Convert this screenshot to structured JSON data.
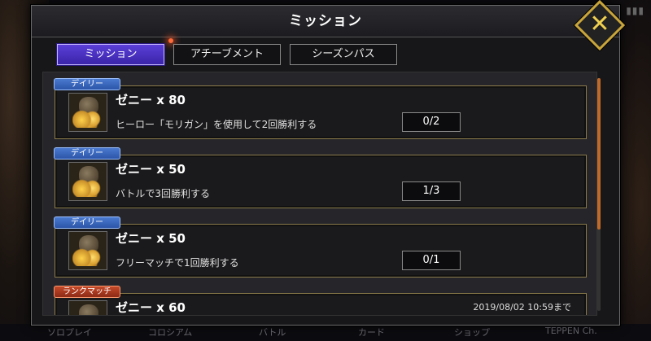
{
  "header": {
    "title": "ミッション"
  },
  "status": {
    "icon": "signal-icon"
  },
  "tabs": [
    {
      "label": "ミッション",
      "active": true
    },
    {
      "label": "アチーブメント",
      "active": false
    },
    {
      "label": "シーズンパス",
      "active": false
    }
  ],
  "missions": [
    {
      "badge": "デイリー",
      "title": "ゼニー x 80",
      "description": "ヒーロー「モリガン」を使用して2回勝利する",
      "progress": "0/2",
      "icon": "zeny-bag-icon"
    },
    {
      "badge": "デイリー",
      "title": "ゼニー x 50",
      "description": "バトルで3回勝利する",
      "progress": "1/3",
      "icon": "zeny-bag-icon"
    },
    {
      "badge": "デイリー",
      "title": "ゼニー x 50",
      "description": "フリーマッチで1回勝利する",
      "progress": "0/1",
      "icon": "zeny-bag-icon"
    },
    {
      "badge": "ランクマッチ",
      "title": "ゼニー x 60",
      "deadline": "2019/08/02 10:59まで",
      "icon": "zeny-bag-icon"
    }
  ],
  "bottom_nav": [
    {
      "label": "ソロプレイ"
    },
    {
      "label": "コロシアム"
    },
    {
      "label": "バトル"
    },
    {
      "label": "カード"
    },
    {
      "label": "ショップ"
    },
    {
      "label": "TEPPEN Ch."
    }
  ],
  "colors": {
    "active_tab": "#4a30c0",
    "daily_badge": "#3a66c0",
    "rank_badge": "#b03a20",
    "close_gold": "#f0d050"
  }
}
